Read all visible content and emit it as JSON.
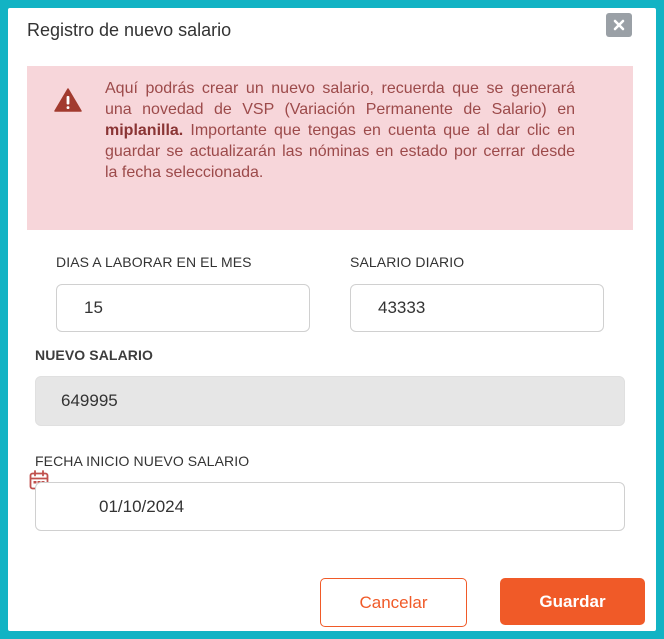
{
  "modal": {
    "title": "Registro de nuevo salario",
    "close_icon": "close-icon"
  },
  "alert": {
    "icon": "warning-triangle-icon",
    "text_before": "Aquí podrás crear un nuevo salario, recuerda que se generará una novedad de VSP (Variación Permanente de Salario) en ",
    "text_bold": "miplanilla.",
    "text_after": " Importante que tengas en cuenta que al dar clic en guardar se actualizarán las nóminas en estado por cerrar desde la fecha seleccionada."
  },
  "form": {
    "dias_label": "DIAS A LABORAR EN EL MES",
    "dias_value": "15",
    "salario_diario_label": "SALARIO DIARIO",
    "salario_diario_value": "43333",
    "nuevo_salario_label": "NUEVO SALARIO",
    "nuevo_salario_value": "649995",
    "fecha_label": "FECHA INICIO NUEVO SALARIO",
    "fecha_value": "01/10/2024",
    "calendar_icon": "calendar-icon"
  },
  "actions": {
    "cancel_label": "Cancelar",
    "save_label": "Guardar"
  },
  "colors": {
    "backdrop": "#12b3c4",
    "alert_bg": "#f7d6da",
    "alert_text": "#9c4a4a",
    "accent": "#f05a28"
  }
}
